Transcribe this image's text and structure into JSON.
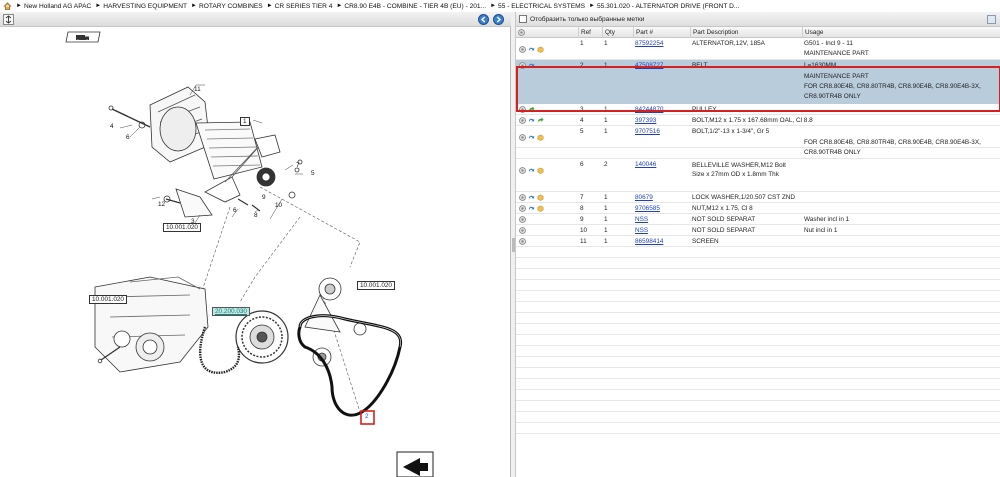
{
  "breadcrumb": {
    "items": [
      "New Holland AG APAC",
      "HARVESTING EQUIPMENT",
      "ROTARY COMBINES",
      "CR SERIES TIER 4",
      "CR8.90 E4B - COMBINE - TIER 4B (EU) - 201...",
      "55 - ELECTRICAL SYSTEMS",
      "55.301.020 - ALTERNATOR DRIVE (FRONT D..."
    ]
  },
  "filter": {
    "label": "Отобразить только выбранные метки"
  },
  "table": {
    "headers": {
      "ref": "Ref",
      "qty": "Qty",
      "part": "Part #",
      "desc": "Part Description",
      "usage": "Usage"
    },
    "rows": [
      {
        "ref": "1",
        "qty": "1",
        "part": "87592254",
        "desc": "ALTERNATOR,12V, 185A",
        "usage": [
          "G501 - Incl 9 - 11",
          "MAINTENANCE PART"
        ]
      },
      {
        "ref": "2",
        "qty": "1",
        "part": "47508727",
        "desc": "BELT",
        "usage": [
          "L=1630MM",
          "MAINTENANCE PART",
          "FOR CR8.80E4B, CR8.80TR4B, CR8.90E4B, CR8.90E4B-3X, CR8.90TR4B ONLY"
        ]
      },
      {
        "ref": "3",
        "qty": "1",
        "part": "84244870",
        "desc": "PULLEY",
        "usage": []
      },
      {
        "ref": "4",
        "qty": "1",
        "part": "397393",
        "desc": "BOLT,M12 x 1.75 x 167.68mm OAL, Cl 8.8",
        "usage": []
      },
      {
        "ref": "5",
        "qty": "1",
        "part": "9707516",
        "desc": "BOLT,1/2\"-13 x 1-3/4\", Gr 5",
        "usage": [
          "",
          "FOR CR8.80E4B, CR8.80TR4B, CR8.90E4B, CR8.90E4B-3X, CR8.90TR4B ONLY"
        ]
      },
      {
        "ref": "6",
        "qty": "2",
        "part": "140046",
        "desc": "BELLEVILLE WASHER,M12 Bolt Size x 27mm OD x 1.8mm Thk",
        "usage": []
      },
      {
        "ref": "7",
        "qty": "1",
        "part": "80679",
        "desc": "LOCK WASHER,1/20.507 CST ZND",
        "usage": []
      },
      {
        "ref": "8",
        "qty": "1",
        "part": "9706585",
        "desc": "NUT,M12 x 1.75, Cl 8",
        "usage": []
      },
      {
        "ref": "9",
        "qty": "1",
        "part": "NSS",
        "desc": "NOT SOLD SEPARAT",
        "usage": [
          "Washer incl in 1"
        ]
      },
      {
        "ref": "10",
        "qty": "1",
        "part": "NSS",
        "desc": "NOT SOLD SEPARAT",
        "usage": [
          "Nut incl in 1"
        ]
      },
      {
        "ref": "11",
        "qty": "1",
        "part": "86598414",
        "desc": "SCREEN",
        "usage": []
      }
    ]
  },
  "diagram": {
    "callouts": {
      "n11": "11",
      "n4": "4",
      "n6a": "6",
      "n7": "7",
      "n5": "5",
      "n9": "9",
      "n12": "12",
      "n3": "3",
      "n6b": "6",
      "n8": "8",
      "n10": "10",
      "n2": "2"
    },
    "refs": {
      "box1": "1",
      "r10001020a": "10.001.020",
      "r10001020b": "10.001.020",
      "r10001020c": "10.001.020",
      "r20200030": "20.200.030"
    }
  },
  "colors": {
    "selection": "#b8ccdc",
    "highlight_border": "#d62020",
    "link": "#1f3fbf"
  }
}
